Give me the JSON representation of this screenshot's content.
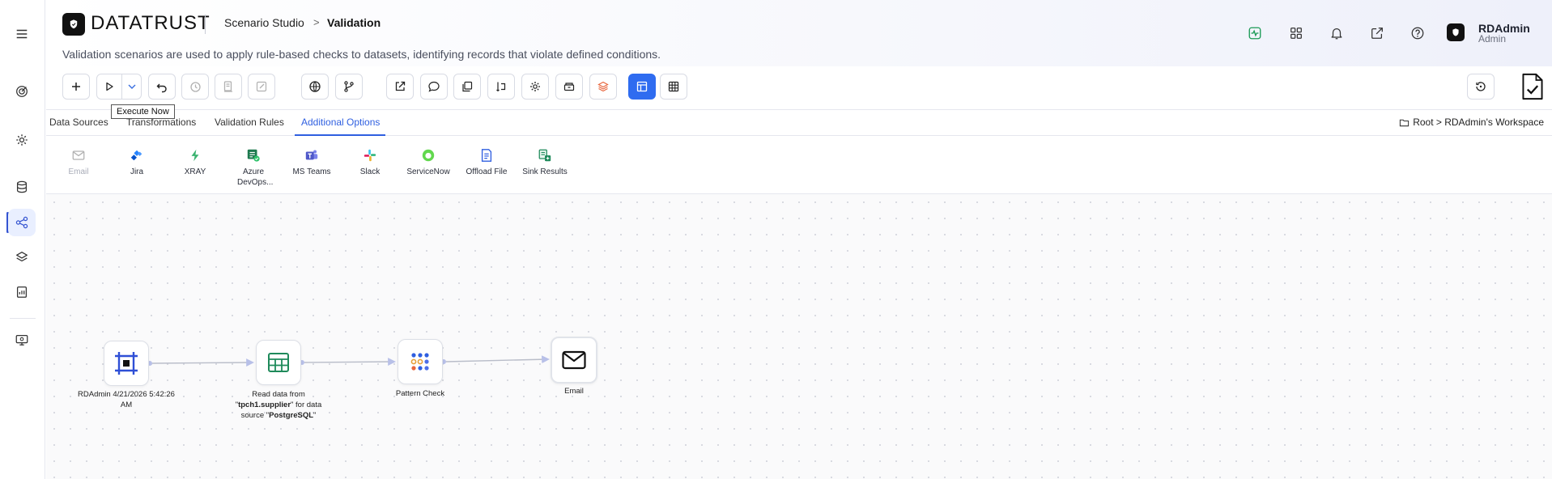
{
  "app": {
    "logo_text": "DATATRUST",
    "breadcrumb": [
      "Scenario Studio",
      "Validation"
    ],
    "breadcrumb_sep": ">",
    "subtitle": "Validation scenarios are used to apply rule-based checks to datasets, identifying records that violate defined conditions."
  },
  "user": {
    "name": "RDAdmin",
    "role": "Admin"
  },
  "toolbar": {
    "tooltip": "Execute Now"
  },
  "tabs": {
    "items": [
      "Data Sources",
      "Transformations",
      "Validation Rules",
      "Additional Options"
    ],
    "active": "Additional Options"
  },
  "workspace_path": "Root > RDAdmin's Workspace",
  "palette": {
    "items": [
      {
        "label": "Email",
        "disabled": true
      },
      {
        "label": "Jira"
      },
      {
        "label": "XRAY"
      },
      {
        "label": "Azure DevOps..."
      },
      {
        "label": "MS Teams"
      },
      {
        "label": "Slack"
      },
      {
        "label": "ServiceNow"
      },
      {
        "label": "Offload File"
      },
      {
        "label": "Sink Results"
      }
    ]
  },
  "flow": {
    "nodes": [
      {
        "name": "start",
        "label": "RDAdmin 4/21/2026 5:42:26 AM"
      },
      {
        "name": "source",
        "label_pre": "Read data from \"",
        "table": "tpch1.supplier",
        "label_mid": "\" for data source \"",
        "source": "PostgreSQL",
        "label_post": "\""
      },
      {
        "name": "rule",
        "label": "Pattern Check"
      },
      {
        "name": "notify",
        "label": "Email"
      }
    ]
  },
  "colors": {
    "accent": "#2f5fe0",
    "active_button": "#2f6cf0",
    "node_start": "#2f4fd6",
    "node_source": "#1f8a5b"
  }
}
